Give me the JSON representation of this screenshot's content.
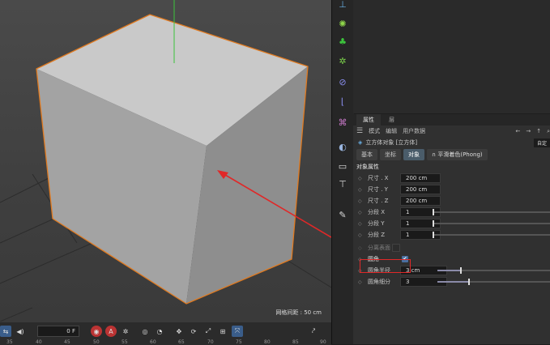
{
  "viewport": {
    "grid_spacing_label": "网格间距 : 50 cm",
    "colors": {
      "bg": "#444444",
      "cube_outline": "#e07a20",
      "axis_y": "#3cc43c",
      "arrow": "#e02828"
    }
  },
  "timeline": {
    "frame_value": "0 F",
    "ticks": [
      "35",
      "40",
      "45",
      "50",
      "55",
      "60",
      "65",
      "70",
      "75",
      "80",
      "85",
      "90"
    ]
  },
  "iconbar": {
    "icons": [
      "info-icon",
      "light-icon",
      "cloner-icon",
      "effector-icon",
      "deformer-icon",
      "spline-icon",
      "tag-icon",
      "camera-icon",
      "floor-icon",
      "edit-icon"
    ]
  },
  "attributes": {
    "tabs": [
      "属性",
      "层"
    ],
    "menu": [
      "模式",
      "编辑",
      "用户数据"
    ],
    "object_title": "立方体对象 [立方体]",
    "custom_tag": "自定",
    "pill_tabs": [
      "基本",
      "坐标",
      "对象"
    ],
    "phong_label": "平滑着色(Phong)",
    "section_title": "对象属性",
    "size": [
      {
        "label": "尺寸 . X",
        "value": "200 cm"
      },
      {
        "label": "尺寸 . Y",
        "value": "200 cm"
      },
      {
        "label": "尺寸 . Z",
        "value": "200 cm"
      }
    ],
    "segments": [
      {
        "label": "分段 X",
        "value": "1"
      },
      {
        "label": "分段 Y",
        "value": "1"
      },
      {
        "label": "分段 Z",
        "value": "1"
      }
    ],
    "separate_surfaces_label": "分离表面",
    "fillet_label": "圆角",
    "fillet_checked": true,
    "fillet_radius": {
      "label": "圆角半径",
      "value": "3 cm"
    },
    "fillet_subdivision": {
      "label": "圆角细分",
      "value": "3"
    }
  }
}
